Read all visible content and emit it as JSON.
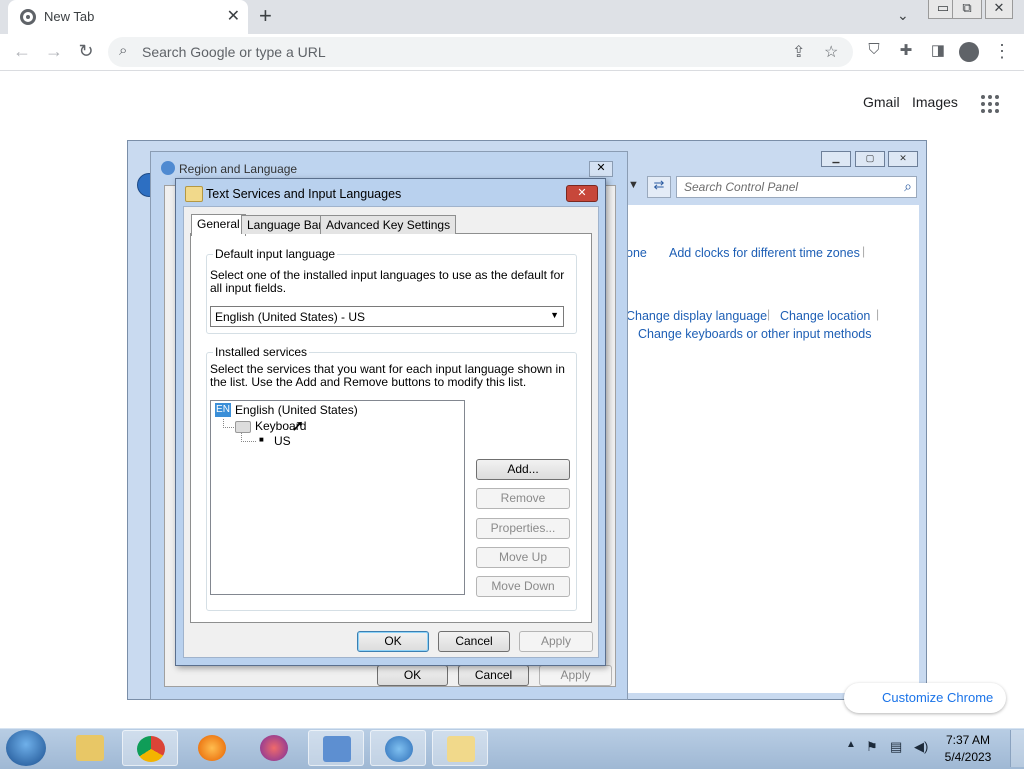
{
  "browser": {
    "tab_title": "New Tab",
    "tab_close": "✕",
    "new_tab": "+",
    "omnibox_placeholder": "Search Google or type a URL",
    "links": {
      "gmail": "Gmail",
      "images": "Images"
    },
    "customize": "Customize Chrome"
  },
  "control_panel": {
    "search_placeholder": "Search Control Panel",
    "links": {
      "zone_partial": "one",
      "add_clocks": "Add clocks for different time zones",
      "change_display_language": "Change display language",
      "change_location": "Change location",
      "change_keyboards": "Change keyboards or other input methods"
    }
  },
  "region_language": {
    "title": "Region and Language",
    "ok": "OK",
    "cancel": "Cancel",
    "apply": "Apply"
  },
  "dialog": {
    "title": "Text Services and Input Languages",
    "tabs": [
      "General",
      "Language Bar",
      "Advanced Key Settings"
    ],
    "default_group": {
      "caption": "Default input language",
      "text": "Select one of the installed input languages to use as the default for all input fields.",
      "selected": "English (United States) - US"
    },
    "installed_group": {
      "caption": "Installed services",
      "text": "Select the services that you want for each input language shown in the list. Use the Add and Remove buttons to modify this list.",
      "tree": {
        "lang_badge": "EN",
        "language": "English (United States)",
        "category": "Keyboard",
        "item": "US"
      }
    },
    "side_buttons": {
      "add": "Add...",
      "remove": "Remove",
      "properties": "Properties...",
      "move_up": "Move Up",
      "move_down": "Move Down"
    },
    "ok": "OK",
    "cancel": "Cancel",
    "apply": "Apply"
  },
  "taskbar": {
    "time": "7:37 AM",
    "date": "5/4/2023"
  }
}
